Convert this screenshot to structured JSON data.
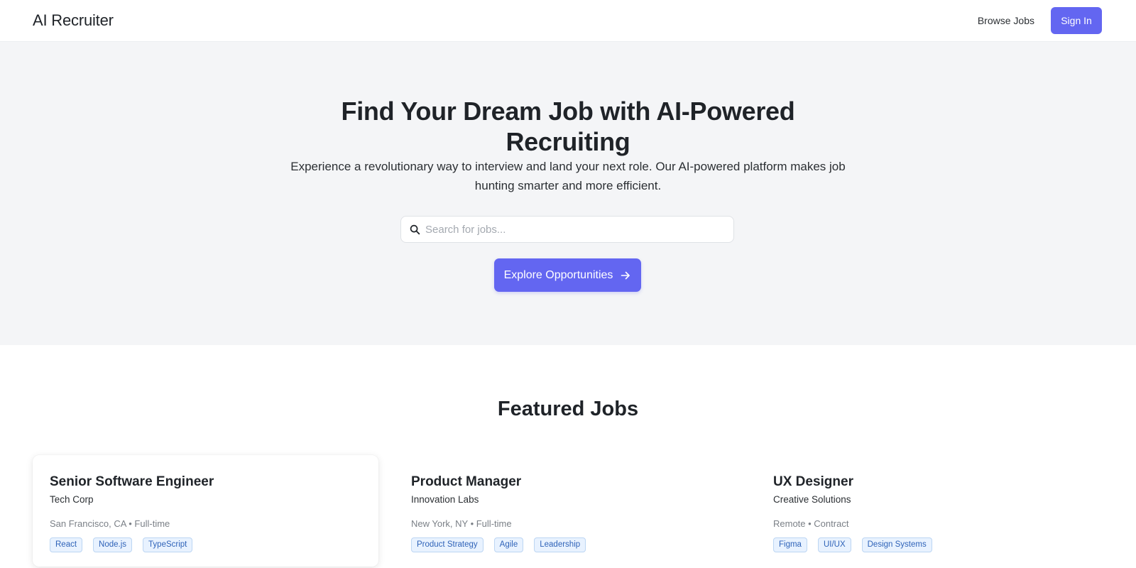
{
  "header": {
    "brand": "AI Recruiter",
    "browse_jobs_label": "Browse Jobs",
    "sign_in_label": "Sign In"
  },
  "hero": {
    "title": "Find Your Dream Job with AI-Powered Recruiting",
    "subtitle": "Experience a revolutionary way to interview and land your next role. Our AI-powered platform makes job hunting smarter and more efficient.",
    "search_placeholder": "Search for jobs...",
    "search_value": "",
    "explore_label": "Explore Opportunities"
  },
  "featured": {
    "title": "Featured Jobs",
    "jobs": [
      {
        "title": "Senior Software Engineer",
        "company": "Tech Corp",
        "meta": "San Francisco, CA • Full-time",
        "tags": [
          "React",
          "Node.js",
          "TypeScript"
        ]
      },
      {
        "title": "Product Manager",
        "company": "Innovation Labs",
        "meta": "New York, NY • Full-time",
        "tags": [
          "Product Strategy",
          "Agile",
          "Leadership"
        ]
      },
      {
        "title": "UX Designer",
        "company": "Creative Solutions",
        "meta": "Remote • Contract",
        "tags": [
          "Figma",
          "UI/UX",
          "Design Systems"
        ]
      }
    ]
  },
  "icons": {
    "search": "search-icon",
    "arrow": "arrow-right-icon"
  },
  "colors": {
    "accent": "#6366f1",
    "hero_background": "#f4f5f7",
    "tag_text": "#2f63b8",
    "tag_background": "#e8f2ff"
  }
}
